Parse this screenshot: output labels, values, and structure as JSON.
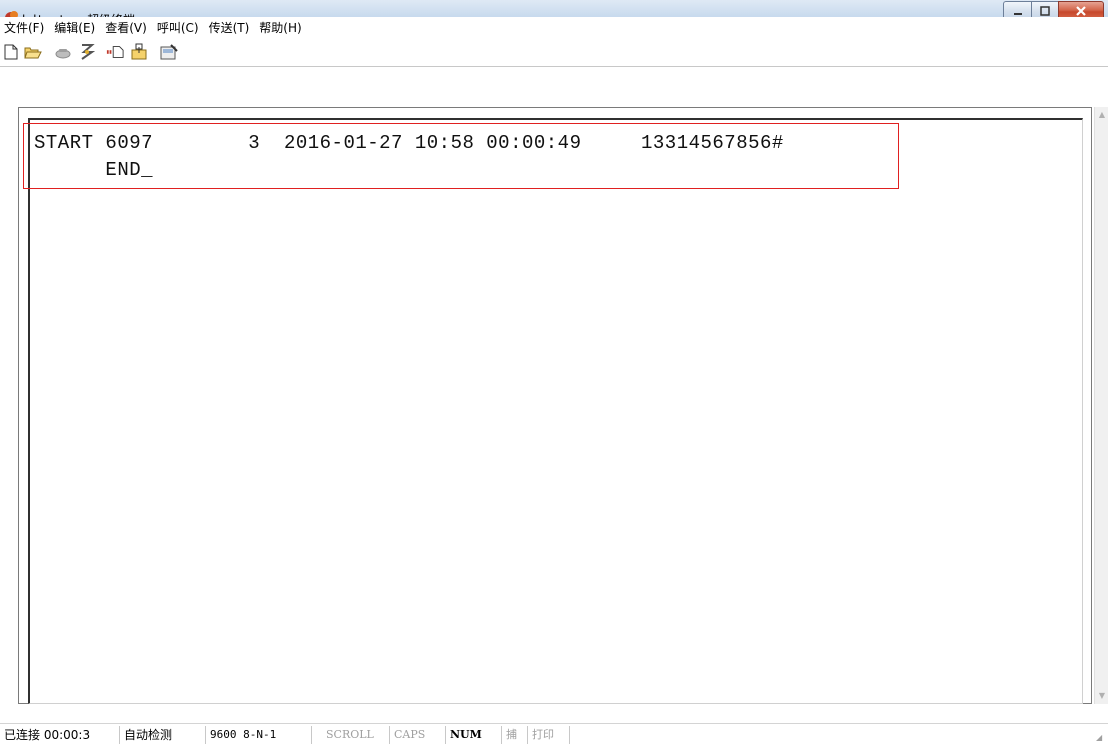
{
  "window": {
    "title": "hdtest - 超级终端"
  },
  "menu": {
    "items": [
      {
        "label": "文件(F)"
      },
      {
        "label": "编辑(E)"
      },
      {
        "label": "查看(V)"
      },
      {
        "label": "呼叫(C)"
      },
      {
        "label": "传送(T)"
      },
      {
        "label": "帮助(H)"
      }
    ]
  },
  "toolbar": {
    "icons": [
      "new-icon",
      "open-icon",
      "call-icon",
      "disconnect-icon",
      "send-icon",
      "receive-icon",
      "properties-icon"
    ]
  },
  "terminal": {
    "line1": "START 6097        3  2016-01-27 10:58 00:00:49     13314567856#",
    "line2": "      END_"
  },
  "statusbar": {
    "connected": "已连接 00:00:3",
    "detect": "自动检测",
    "settings": "9600 8-N-1",
    "scroll": "SCROLL",
    "caps": "CAPS",
    "num": "NUM",
    "capture": "捕",
    "print": "打印"
  },
  "colors": {
    "highlight": "#e02020",
    "titlebar": "#c9dbee",
    "close_button": "#c6472c"
  }
}
